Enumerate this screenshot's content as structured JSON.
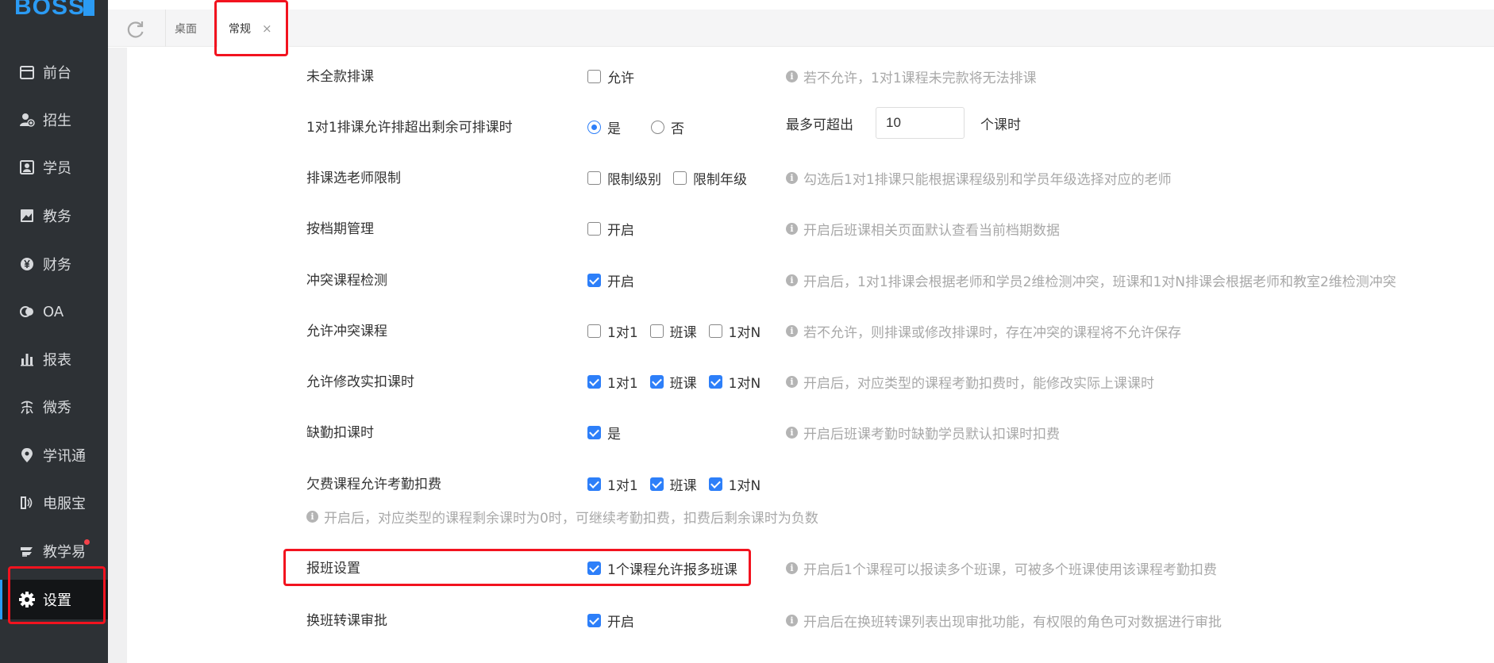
{
  "logo": {
    "text": "BOSS",
    "badge": ""
  },
  "sidebar": {
    "items": [
      {
        "label": "前台",
        "icon": "calendar-icon"
      },
      {
        "label": "招生",
        "icon": "user-add-icon"
      },
      {
        "label": "学员",
        "icon": "student-card-icon"
      },
      {
        "label": "教务",
        "icon": "book-icon"
      },
      {
        "label": "财务",
        "icon": "yen-icon"
      },
      {
        "label": "OA",
        "icon": "chat-bubbles-icon"
      },
      {
        "label": "报表",
        "icon": "bar-chart-icon"
      },
      {
        "label": "微秀",
        "icon": "xiu-icon"
      },
      {
        "label": "学讯通",
        "icon": "location-pin-icon"
      },
      {
        "label": "电服宝",
        "icon": "phone-icon"
      },
      {
        "label": "教学易",
        "icon": "teaching-icon"
      },
      {
        "label": "设置",
        "icon": "gear-icon"
      }
    ],
    "active_index": 11,
    "notification_dot_index": 10
  },
  "tabs": {
    "items": [
      {
        "label": "桌面",
        "closable": false
      },
      {
        "label": "常规",
        "closable": true,
        "close_label": "×"
      }
    ],
    "active_index": 1
  },
  "settings": {
    "rows": [
      {
        "label": "未全款排课",
        "options": [
          {
            "type": "checkbox",
            "label": "允许",
            "checked": false
          }
        ],
        "hint": "若不允许，1对1课程未完款将无法排课"
      },
      {
        "label": "1对1排课允许排超出剩余可排课时",
        "options": [
          {
            "type": "radio",
            "label": "是",
            "checked": true
          },
          {
            "type": "radio",
            "label": "否",
            "checked": false
          }
        ],
        "extra": {
          "prefix": "最多可超出",
          "value": "10",
          "suffix": "个课时"
        }
      },
      {
        "label": "排课选老师限制",
        "options": [
          {
            "type": "checkbox",
            "label": "限制级别",
            "checked": false
          },
          {
            "type": "checkbox",
            "label": "限制年级",
            "checked": false
          }
        ],
        "hint": "勾选后1对1排课只能根据课程级别和学员年级选择对应的老师"
      },
      {
        "label": "按档期管理",
        "options": [
          {
            "type": "checkbox",
            "label": "开启",
            "checked": false
          }
        ],
        "hint": "开启后班课相关页面默认查看当前档期数据"
      },
      {
        "label": "冲突课程检测",
        "options": [
          {
            "type": "checkbox",
            "label": "开启",
            "checked": true
          }
        ],
        "hint": "开启后，1对1排课会根据老师和学员2维检测冲突，班课和1对N排课会根据老师和教室2维检测冲突"
      },
      {
        "label": "允许冲突课程",
        "options": [
          {
            "type": "checkbox",
            "label": "1对1",
            "checked": false
          },
          {
            "type": "checkbox",
            "label": "班课",
            "checked": false
          },
          {
            "type": "checkbox",
            "label": "1对N",
            "checked": false
          }
        ],
        "hint": "若不允许，则排课或修改排课时，存在冲突的课程将不允许保存"
      },
      {
        "label": "允许修改实扣课时",
        "options": [
          {
            "type": "checkbox",
            "label": "1对1",
            "checked": true
          },
          {
            "type": "checkbox",
            "label": "班课",
            "checked": true
          },
          {
            "type": "checkbox",
            "label": "1对N",
            "checked": true
          }
        ],
        "hint": "开启后，对应类型的课程考勤扣费时，能修改实际上课课时"
      },
      {
        "label": "缺勤扣课时",
        "options": [
          {
            "type": "checkbox",
            "label": "是",
            "checked": true
          }
        ],
        "hint": "开启后班课考勤时缺勤学员默认扣课时扣费"
      },
      {
        "label": "欠费课程允许考勤扣费",
        "options": [
          {
            "type": "checkbox",
            "label": "1对1",
            "checked": true
          },
          {
            "type": "checkbox",
            "label": "班课",
            "checked": true
          },
          {
            "type": "checkbox",
            "label": "1对N",
            "checked": true
          }
        ],
        "hint_below": "开启后，对应类型的课程剩余课时为0时，可继续考勤扣费，扣费后剩余课时为负数"
      },
      {
        "label": "报班设置",
        "options": [
          {
            "type": "checkbox",
            "label": "1个课程允许报多班课",
            "checked": true
          }
        ],
        "hint": "开启后1个课程可以报读多个班课，可被多个班课使用该课程考勤扣费"
      },
      {
        "label": "换班转课审批",
        "options": [
          {
            "type": "checkbox",
            "label": "开启",
            "checked": true
          }
        ],
        "hint": "开启后在换班转课列表出现审批功能，有权限的角色可对数据进行审批"
      }
    ]
  },
  "colors": {
    "accent": "#2d7ff9",
    "sidebar_bg": "#2d3135",
    "highlight_red": "#f2131f",
    "hint_gray": "#a8a8a8"
  }
}
